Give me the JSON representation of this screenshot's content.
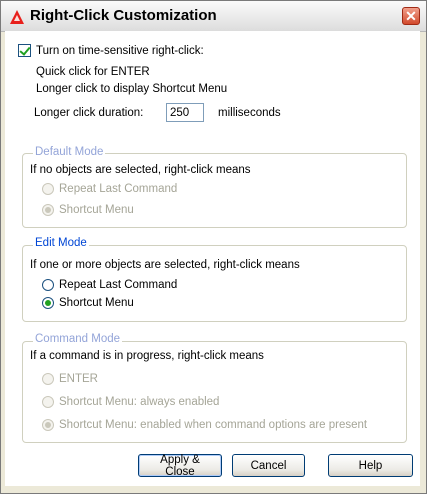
{
  "window": {
    "title": "Right-Click Customization",
    "close_glyph": "✕"
  },
  "time_sensitive": {
    "checkbox_label": "Turn on time-sensitive right-click:",
    "checked": true,
    "line1": "Quick click for ENTER",
    "line2": "Longer click to display Shortcut Menu",
    "duration_label": "Longer click duration:",
    "duration_value": "250",
    "duration_unit": "milliseconds"
  },
  "default_mode": {
    "legend": "Default Mode",
    "description": "If no objects are selected, right-click means",
    "options": [
      {
        "label": "Repeat Last Command",
        "selected": false
      },
      {
        "label": "Shortcut Menu",
        "selected": true
      }
    ],
    "enabled": false
  },
  "edit_mode": {
    "legend": "Edit Mode",
    "description": "If one or more objects are selected, right-click means",
    "options": [
      {
        "label": "Repeat Last Command",
        "selected": false
      },
      {
        "label": "Shortcut Menu",
        "selected": true
      }
    ],
    "enabled": true
  },
  "command_mode": {
    "legend": "Command Mode",
    "description": "If a command is in progress, right-click means",
    "options": [
      {
        "label": "ENTER",
        "selected": false
      },
      {
        "label": "Shortcut Menu: always enabled",
        "selected": false
      },
      {
        "label": "Shortcut Menu: enabled when command options are present",
        "selected": true
      }
    ],
    "enabled": false
  },
  "buttons": {
    "apply_close": "Apply & Close",
    "cancel": "Cancel",
    "help": "Help"
  },
  "colors": {
    "legend": "#0046d5",
    "radio_dot": "#21a121",
    "disabled_text": "#a5a597",
    "close_button": "#d24a2c"
  },
  "icons": {
    "app": "autocad-a-icon",
    "close": "close-icon"
  }
}
